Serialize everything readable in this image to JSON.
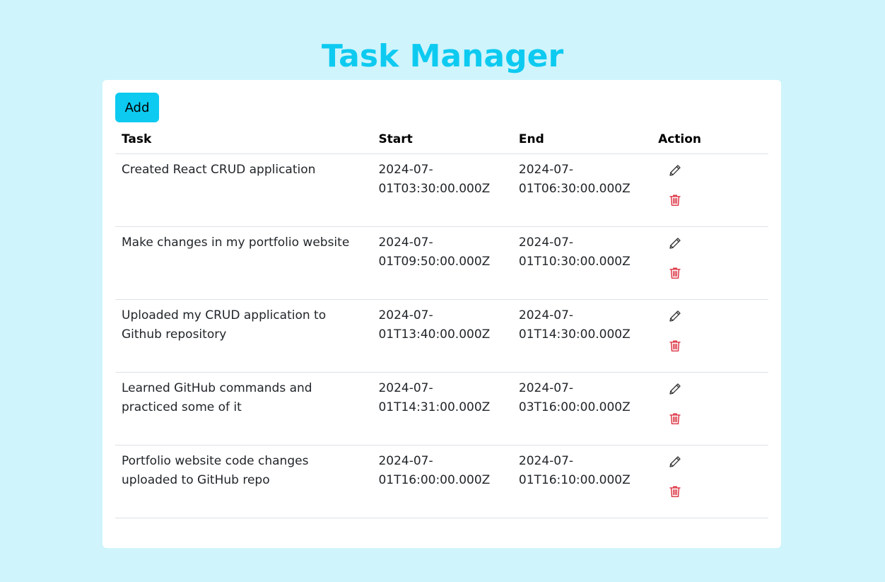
{
  "header": {
    "title": "Task Manager"
  },
  "toolbar": {
    "add_label": "Add"
  },
  "table": {
    "columns": {
      "task": "Task",
      "start": "Start",
      "end": "End",
      "action": "Action"
    },
    "rows": [
      {
        "task": "Created React CRUD application",
        "start": "2024-07-01T03:30:00.000Z",
        "end": "2024-07-01T06:30:00.000Z",
        "actions": [
          "edit-pencil-icon",
          "delete-trash-icon"
        ]
      },
      {
        "task": "Make changes in my portfolio website",
        "start": "2024-07-01T09:50:00.000Z",
        "end": "2024-07-01T10:30:00.000Z",
        "actions": [
          "edit-pencil-icon",
          "delete-trash-icon"
        ]
      },
      {
        "task": "Uploaded my CRUD application to Github repository",
        "start": "2024-07-01T13:40:00.000Z",
        "end": "2024-07-01T14:30:00.000Z",
        "actions": [
          "edit-pencil-icon",
          "delete-trash-icon"
        ]
      },
      {
        "task": "Learned GitHub commands and practiced some of it",
        "start": "2024-07-01T14:31:00.000Z",
        "end": "2024-07-03T16:00:00.000Z",
        "actions": [
          "edit-pencil-icon",
          "delete-trash-icon"
        ]
      },
      {
        "task": "Portfolio website code changes uploaded to GitHub repo",
        "start": "2024-07-01T16:00:00.000Z",
        "end": "2024-07-01T16:10:00.000Z",
        "actions": [
          "edit-pencil-icon",
          "delete-trash-icon"
        ]
      }
    ]
  },
  "colors": {
    "page_background": "#cff4fc",
    "accent": "#0dcaf0",
    "card_background": "#ffffff",
    "delete_icon": "#dc3545",
    "edit_icon": "#333333"
  }
}
